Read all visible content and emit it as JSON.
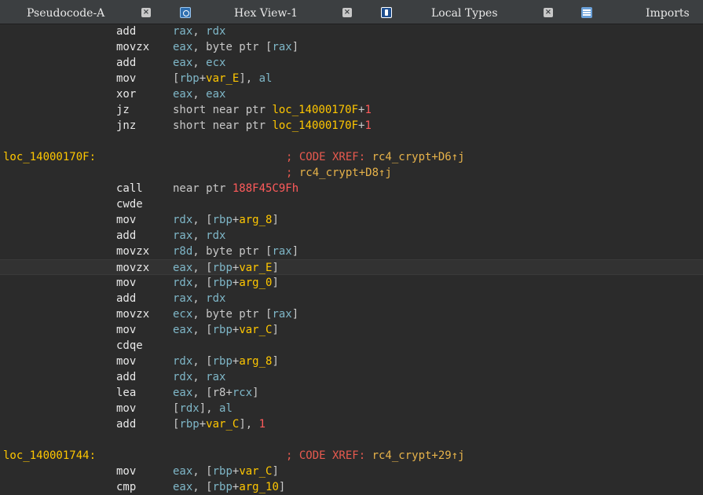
{
  "tabs": [
    {
      "label": "Pseudocode-A",
      "icon": "close-icon"
    },
    {
      "label": "Hex View-1",
      "icon": "hex-view-icon"
    },
    {
      "label": "Local Types",
      "icon": "local-types-icon"
    },
    {
      "label": "Imports",
      "icon": "imports-icon"
    }
  ],
  "listing": {
    "lines": [
      {
        "mnemonic": "add",
        "operands": [
          {
            "t": "reg",
            "v": "rax"
          },
          {
            "t": "txt",
            "v": ", "
          },
          {
            "t": "reg",
            "v": "rdx"
          }
        ]
      },
      {
        "mnemonic": "movzx",
        "operands": [
          {
            "t": "reg",
            "v": "eax"
          },
          {
            "t": "txt",
            "v": ", byte ptr ["
          },
          {
            "t": "reg",
            "v": "rax"
          },
          {
            "t": "txt",
            "v": "]"
          }
        ]
      },
      {
        "mnemonic": "add",
        "operands": [
          {
            "t": "reg",
            "v": "eax"
          },
          {
            "t": "txt",
            "v": ", "
          },
          {
            "t": "reg",
            "v": "ecx"
          }
        ]
      },
      {
        "mnemonic": "mov",
        "operands": [
          {
            "t": "txt",
            "v": "["
          },
          {
            "t": "reg",
            "v": "rbp"
          },
          {
            "t": "txt",
            "v": "+"
          },
          {
            "t": "sym",
            "v": "var_E"
          },
          {
            "t": "txt",
            "v": "], "
          },
          {
            "t": "reg",
            "v": "al"
          }
        ]
      },
      {
        "mnemonic": "xor",
        "operands": [
          {
            "t": "reg",
            "v": "eax"
          },
          {
            "t": "txt",
            "v": ", "
          },
          {
            "t": "reg",
            "v": "eax"
          }
        ]
      },
      {
        "mnemonic": "jz",
        "operands": [
          {
            "t": "txt",
            "v": "short near ptr "
          },
          {
            "t": "sym",
            "v": "loc_14000170F"
          },
          {
            "t": "txt",
            "v": "+"
          },
          {
            "t": "num",
            "v": "1"
          }
        ]
      },
      {
        "mnemonic": "jnz",
        "operands": [
          {
            "t": "txt",
            "v": "short near ptr "
          },
          {
            "t": "sym",
            "v": "loc_14000170F"
          },
          {
            "t": "txt",
            "v": "+"
          },
          {
            "t": "num",
            "v": "1"
          }
        ]
      },
      {
        "blank": true
      },
      {
        "label": "loc_14000170F:",
        "comment": [
          {
            "t": "cmtkey",
            "v": "; CODE XREF: "
          },
          {
            "t": "cmtref",
            "v": "rc4_crypt+D6↑j"
          }
        ]
      },
      {
        "comment": [
          {
            "t": "cmtkey",
            "v": "; "
          },
          {
            "t": "cmtref",
            "v": "rc4_crypt+D8↑j"
          }
        ]
      },
      {
        "mnemonic": "call",
        "operands": [
          {
            "t": "txt",
            "v": "near ptr "
          },
          {
            "t": "num",
            "v": "188F45C9Fh"
          }
        ]
      },
      {
        "mnemonic": "cwde",
        "operands": []
      },
      {
        "mnemonic": "mov",
        "operands": [
          {
            "t": "reg",
            "v": "rdx"
          },
          {
            "t": "txt",
            "v": ", ["
          },
          {
            "t": "reg",
            "v": "rbp"
          },
          {
            "t": "txt",
            "v": "+"
          },
          {
            "t": "sym",
            "v": "arg_8"
          },
          {
            "t": "txt",
            "v": "]"
          }
        ]
      },
      {
        "mnemonic": "add",
        "operands": [
          {
            "t": "reg",
            "v": "rax"
          },
          {
            "t": "txt",
            "v": ", "
          },
          {
            "t": "reg",
            "v": "rdx"
          }
        ]
      },
      {
        "mnemonic": "movzx",
        "operands": [
          {
            "t": "reg",
            "v": "r8d"
          },
          {
            "t": "txt",
            "v": ", byte ptr ["
          },
          {
            "t": "reg",
            "v": "rax"
          },
          {
            "t": "txt",
            "v": "]"
          }
        ]
      },
      {
        "mnemonic": "movzx",
        "highlight": true,
        "operands": [
          {
            "t": "reg",
            "v": "eax"
          },
          {
            "t": "txt",
            "v": ", ["
          },
          {
            "t": "reg",
            "v": "rbp"
          },
          {
            "t": "txt",
            "v": "+"
          },
          {
            "t": "sym",
            "v": "var_E"
          },
          {
            "t": "txt",
            "v": "]"
          }
        ]
      },
      {
        "mnemonic": "mov",
        "operands": [
          {
            "t": "reg",
            "v": "rdx"
          },
          {
            "t": "txt",
            "v": ", ["
          },
          {
            "t": "reg",
            "v": "rbp"
          },
          {
            "t": "txt",
            "v": "+"
          },
          {
            "t": "sym",
            "v": "arg_0"
          },
          {
            "t": "txt",
            "v": "]"
          }
        ]
      },
      {
        "mnemonic": "add",
        "operands": [
          {
            "t": "reg",
            "v": "rax"
          },
          {
            "t": "txt",
            "v": ", "
          },
          {
            "t": "reg",
            "v": "rdx"
          }
        ]
      },
      {
        "mnemonic": "movzx",
        "operands": [
          {
            "t": "reg",
            "v": "ecx"
          },
          {
            "t": "txt",
            "v": ", byte ptr ["
          },
          {
            "t": "reg",
            "v": "rax"
          },
          {
            "t": "txt",
            "v": "]"
          }
        ]
      },
      {
        "mnemonic": "mov",
        "operands": [
          {
            "t": "reg",
            "v": "eax"
          },
          {
            "t": "txt",
            "v": ", ["
          },
          {
            "t": "reg",
            "v": "rbp"
          },
          {
            "t": "txt",
            "v": "+"
          },
          {
            "t": "sym",
            "v": "var_C"
          },
          {
            "t": "txt",
            "v": "]"
          }
        ]
      },
      {
        "mnemonic": "cdqe",
        "operands": []
      },
      {
        "mnemonic": "mov",
        "operands": [
          {
            "t": "reg",
            "v": "rdx"
          },
          {
            "t": "txt",
            "v": ", ["
          },
          {
            "t": "reg",
            "v": "rbp"
          },
          {
            "t": "txt",
            "v": "+"
          },
          {
            "t": "sym",
            "v": "arg_8"
          },
          {
            "t": "txt",
            "v": "]"
          }
        ]
      },
      {
        "mnemonic": "add",
        "operands": [
          {
            "t": "reg",
            "v": "rdx"
          },
          {
            "t": "txt",
            "v": ", "
          },
          {
            "t": "reg",
            "v": "rax"
          }
        ]
      },
      {
        "mnemonic": "lea",
        "operands": [
          {
            "t": "reg",
            "v": "eax"
          },
          {
            "t": "txt",
            "v": ", [r8+"
          },
          {
            "t": "reg",
            "v": "rcx"
          },
          {
            "t": "txt",
            "v": "]"
          }
        ]
      },
      {
        "mnemonic": "mov",
        "operands": [
          {
            "t": "txt",
            "v": "["
          },
          {
            "t": "reg",
            "v": "rdx"
          },
          {
            "t": "txt",
            "v": "], "
          },
          {
            "t": "reg",
            "v": "al"
          }
        ]
      },
      {
        "mnemonic": "add",
        "operands": [
          {
            "t": "txt",
            "v": "["
          },
          {
            "t": "reg",
            "v": "rbp"
          },
          {
            "t": "txt",
            "v": "+"
          },
          {
            "t": "sym",
            "v": "var_C"
          },
          {
            "t": "txt",
            "v": "], "
          },
          {
            "t": "num",
            "v": "1"
          }
        ]
      },
      {
        "blank": true
      },
      {
        "label": "loc_140001744:",
        "comment": [
          {
            "t": "cmtkey",
            "v": "; CODE XREF: "
          },
          {
            "t": "cmtref",
            "v": "rc4_crypt+29↑j"
          }
        ]
      },
      {
        "mnemonic": "mov",
        "operands": [
          {
            "t": "reg",
            "v": "eax"
          },
          {
            "t": "txt",
            "v": ", ["
          },
          {
            "t": "reg",
            "v": "rbp"
          },
          {
            "t": "txt",
            "v": "+"
          },
          {
            "t": "sym",
            "v": "var_C"
          },
          {
            "t": "txt",
            "v": "]"
          }
        ]
      },
      {
        "mnemonic": "cmp",
        "operands": [
          {
            "t": "reg",
            "v": "eax"
          },
          {
            "t": "txt",
            "v": ", ["
          },
          {
            "t": "reg",
            "v": "rbp"
          },
          {
            "t": "txt",
            "v": "+"
          },
          {
            "t": "sym",
            "v": "arg_10"
          },
          {
            "t": "txt",
            "v": "]"
          }
        ]
      }
    ]
  }
}
